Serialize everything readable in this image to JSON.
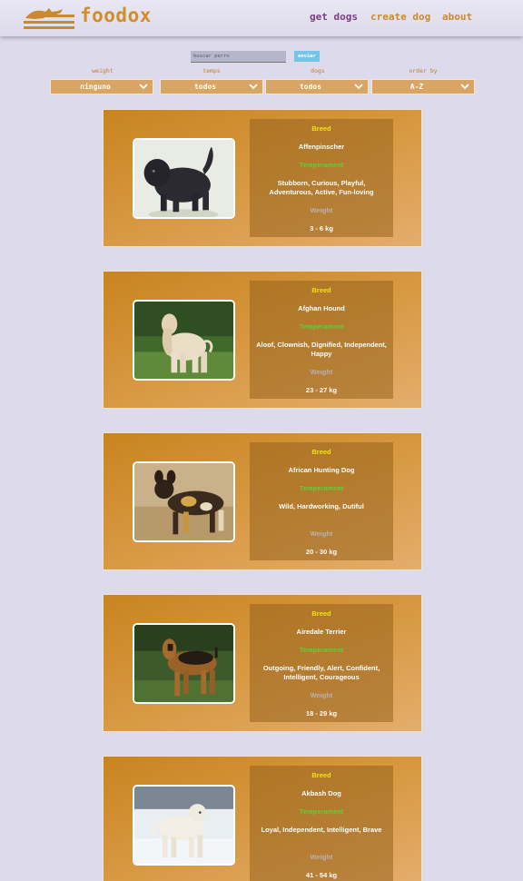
{
  "navbar": {
    "brand": "foodox",
    "links": [
      "get dogs",
      "create dog",
      "about"
    ]
  },
  "search": {
    "placeholder": "buscar perro",
    "button_label": "enviar"
  },
  "filters": [
    {
      "label": "weight",
      "selected": "ninguno"
    },
    {
      "label": "temps",
      "selected": "todos"
    },
    {
      "label": "dogs",
      "selected": "todos"
    },
    {
      "label": "order by",
      "selected": "A-Z"
    }
  ],
  "card_labels": {
    "breed": "Breed",
    "temperament": "Temperament",
    "weight": "Weight"
  },
  "dogs": [
    {
      "name": "Affenpinscher",
      "temperament": "Stubborn, Curious, Playful, Adventurous, Active, Fun-loving",
      "weight": "3 - 6 kg"
    },
    {
      "name": "Afghan Hound",
      "temperament": "Aloof, Clownish, Dignified, Independent, Happy",
      "weight": "23 - 27 kg"
    },
    {
      "name": "African Hunting Dog",
      "temperament": "Wild, Hardworking, Dutiful",
      "weight": "20 - 30 kg"
    },
    {
      "name": "Airedale Terrier",
      "temperament": "Outgoing, Friendly, Alert, Confident, Intelligent, Courageous",
      "weight": "18 - 29 kg"
    },
    {
      "name": "Akbash Dog",
      "temperament": "Loyal, Independent, Intelligent, Brave",
      "weight": "41 - 54 kg"
    }
  ],
  "colors": {
    "background": "#dddbeb",
    "brand": "#d08d2a",
    "nav_active": "#7b3b86",
    "card_gradient_start": "#c8841f",
    "card_gradient_end": "#e4ad6c",
    "breed_label": "#f3e40e",
    "temperament_label": "#5ad13a",
    "weight_label": "#b8b2b0",
    "search_button": "#74c4e9"
  },
  "icons": [
    "running-dog-logo-icon",
    "chevron-down-icon"
  ]
}
